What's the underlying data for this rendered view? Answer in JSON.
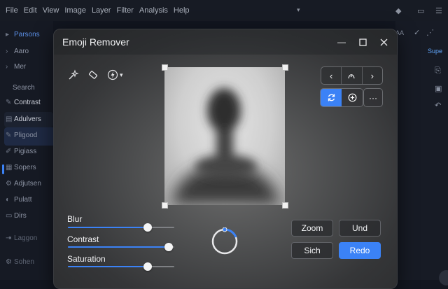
{
  "menubar": {
    "items": [
      "File",
      "Edit",
      "View",
      "Image",
      "Layer",
      "Filter",
      "Analysis",
      "Help"
    ]
  },
  "sidebar": {
    "items": [
      {
        "label": "Parsons",
        "icon": "chevron-down-icon"
      },
      {
        "label": "Aaro",
        "icon": "chevron-right-icon"
      },
      {
        "label": "Mer",
        "icon": "chevron-right-icon"
      },
      {
        "label": "Search",
        "icon": ""
      },
      {
        "label": "Contrast",
        "icon": "brush-icon"
      },
      {
        "label": "Adulvers",
        "icon": "layers-icon"
      },
      {
        "label": "Pligood",
        "icon": "brush-icon"
      },
      {
        "label": "Pigiass",
        "icon": "pen-icon"
      },
      {
        "label": "Sopers",
        "icon": "grid-icon"
      },
      {
        "label": "Adjutsen",
        "icon": "sliders-icon"
      },
      {
        "label": "Pulatt",
        "icon": "palette-icon"
      },
      {
        "label": "Dirs",
        "icon": "folder-icon"
      },
      {
        "label": "Laggon",
        "icon": "logout-icon"
      },
      {
        "label": "Sohen",
        "icon": "settings-icon"
      }
    ]
  },
  "right_panel": {
    "tab_label": "Supe",
    "top_label": "AA"
  },
  "dialog": {
    "title": "Emoji Remover",
    "sliders": [
      {
        "label": "Blur",
        "value": 0.75
      },
      {
        "label": "Contrast",
        "value": 0.95
      },
      {
        "label": "Saturation",
        "value": 0.75
      }
    ],
    "buttons": {
      "zoom": "Zoom",
      "undo": "Und",
      "save": "Sich",
      "redo": "Redo"
    },
    "more": "···"
  }
}
